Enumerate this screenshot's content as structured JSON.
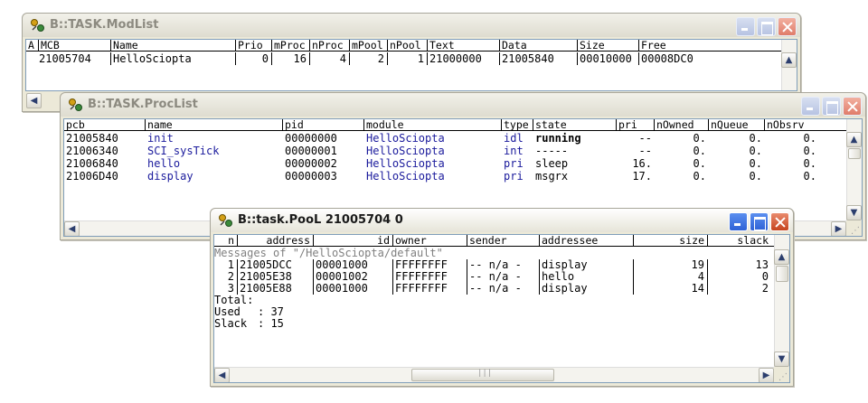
{
  "modlist": {
    "title": "B::TASK.ModList",
    "columns": [
      "A",
      "MCB",
      "Name",
      "Prio",
      "mProc",
      "nProc",
      "mPool",
      "nPool",
      "Text",
      "Data",
      "Size",
      "Free"
    ],
    "rows": [
      {
        "a": "",
        "mcb": "21005704",
        "name": "HelloSciopta",
        "prio": "0",
        "mproc": "16",
        "nproc": "4",
        "mpool": "2",
        "npool": "1",
        "text": "21000000",
        "data": "21005840",
        "size": "00010000",
        "free": "00008DC0"
      }
    ]
  },
  "proclist": {
    "title": "B::TASK.ProcList",
    "columns": [
      "pcb",
      "name",
      "pid",
      "module",
      "type",
      "state",
      "pri",
      "nOwned",
      "nQueue",
      "nObsrv"
    ],
    "rows": [
      {
        "pcb": "21005840",
        "name": "init",
        "pid": "00000000",
        "module": "HelloSciopta",
        "type": "idl",
        "state": "running",
        "pri": "--",
        "nowned": "0.",
        "nqueue": "0.",
        "nobsrv": "0."
      },
      {
        "pcb": "21006340",
        "name": "SCI_sysTick",
        "pid": "00000001",
        "module": "HelloSciopta",
        "type": "int",
        "state": "-----",
        "pri": "--",
        "nowned": "0.",
        "nqueue": "0.",
        "nobsrv": "0."
      },
      {
        "pcb": "21006840",
        "name": "hello",
        "pid": "00000002",
        "module": "HelloSciopta",
        "type": "pri",
        "state": "sleep",
        "pri": "16.",
        "nowned": "0.",
        "nqueue": "0.",
        "nobsrv": "0."
      },
      {
        "pcb": "21006D40",
        "name": "display",
        "pid": "00000003",
        "module": "HelloSciopta",
        "type": "pri",
        "state": "msgrx",
        "pri": "17.",
        "nowned": "0.",
        "nqueue": "0.",
        "nobsrv": "0."
      }
    ]
  },
  "pool": {
    "title": "B::task.PooL 21005704 0",
    "columns": [
      "n",
      "address",
      "id",
      "owner",
      "sender",
      "addressee",
      "size",
      "slack"
    ],
    "section_label": "Messages of \"/HelloSciopta/default\"",
    "rows": [
      {
        "n": "1",
        "address": "21005DCC",
        "id": "00001000",
        "owner": "FFFFFFFF",
        "sender": "-- n/a -",
        "addressee": "display",
        "size": "19",
        "slack": "13"
      },
      {
        "n": "2",
        "address": "21005E38",
        "id": "00001002",
        "owner": "FFFFFFFF",
        "sender": "-- n/a -",
        "addressee": "hello",
        "size": "4",
        "slack": "0"
      },
      {
        "n": "3",
        "address": "21005E88",
        "id": "00001000",
        "owner": "FFFFFFFF",
        "sender": "-- n/a -",
        "addressee": "display",
        "size": "14",
        "slack": "2"
      }
    ],
    "total_label": "Total:",
    "used_label": "Used",
    "used_value": ": 37",
    "slack_label": "Slack",
    "slack_value": ": 15"
  },
  "icons": {
    "app": "bus-icon",
    "minimize": "minimize-icon",
    "maximize": "maximize-icon",
    "close": "close-icon"
  },
  "colors": {
    "title_active": "#1a1a1a",
    "title_inactive": "#8c8a80",
    "link_blue": "#1a1a9c",
    "close_red": "#c6441f"
  }
}
